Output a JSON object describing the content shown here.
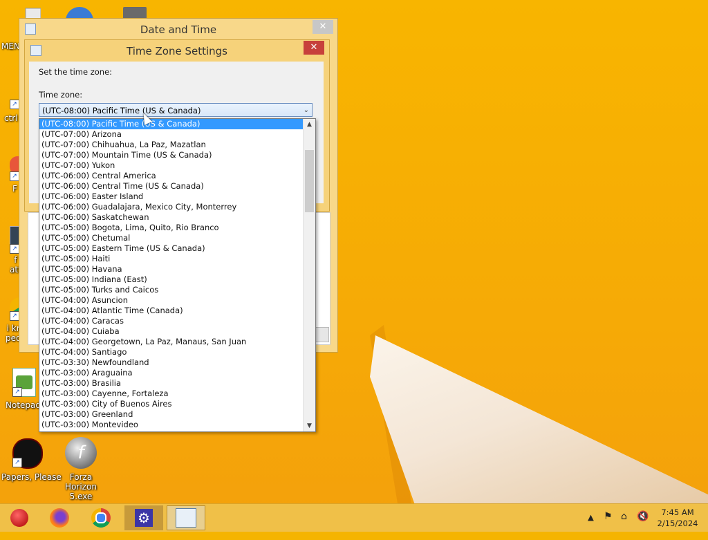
{
  "desktop": {
    "icons": [
      {
        "label": "MEN",
        "icon": "recycle-bin-icon"
      },
      {
        "label": "ctrl",
        "icon": "shortcut-icon"
      },
      {
        "label": "F",
        "icon": "app-icon"
      },
      {
        "label": "f\natt",
        "icon": "app-icon"
      },
      {
        "label": "i kr\npeo",
        "icon": "chrome-icon"
      },
      {
        "label": "Notepad",
        "icon": "notepad-icon"
      },
      {
        "label": "Papers, Please",
        "icon": "game-icon"
      },
      {
        "label": "Forza Horizon 5.exe",
        "icon": "flash-icon"
      }
    ]
  },
  "date_time_window": {
    "title": "Date and Time",
    "close": "✕"
  },
  "tz_window": {
    "title": "Time Zone Settings",
    "close": "✕",
    "set_label": "Set the time zone:",
    "tz_label": "Time zone:",
    "selected": "(UTC-08:00) Pacific Time (US & Canada)",
    "options": [
      "(UTC-08:00) Pacific Time (US & Canada)",
      "(UTC-07:00) Arizona",
      "(UTC-07:00) Chihuahua, La Paz, Mazatlan",
      "(UTC-07:00) Mountain Time (US & Canada)",
      "(UTC-07:00) Yukon",
      "(UTC-06:00) Central America",
      "(UTC-06:00) Central Time (US & Canada)",
      "(UTC-06:00) Easter Island",
      "(UTC-06:00) Guadalajara, Mexico City, Monterrey",
      "(UTC-06:00) Saskatchewan",
      "(UTC-05:00) Bogota, Lima, Quito, Rio Branco",
      "(UTC-05:00) Chetumal",
      "(UTC-05:00) Eastern Time (US & Canada)",
      "(UTC-05:00) Haiti",
      "(UTC-05:00) Havana",
      "(UTC-05:00) Indiana (East)",
      "(UTC-05:00) Turks and Caicos",
      "(UTC-04:00) Asuncion",
      "(UTC-04:00) Atlantic Time (Canada)",
      "(UTC-04:00) Caracas",
      "(UTC-04:00) Cuiaba",
      "(UTC-04:00) Georgetown, La Paz, Manaus, San Juan",
      "(UTC-04:00) Santiago",
      "(UTC-03:30) Newfoundland",
      "(UTC-03:00) Araguaina",
      "(UTC-03:00) Brasilia",
      "(UTC-03:00) Cayenne, Fortaleza",
      "(UTC-03:00) City of Buenos Aires",
      "(UTC-03:00) Greenland",
      "(UTC-03:00) Montevideo"
    ]
  },
  "taskbar": {
    "apps": [
      "ornament-icon",
      "firefox-icon",
      "chrome-icon",
      "settings-icon",
      "date-time-icon"
    ],
    "time": "7:45 AM",
    "date": "2/15/2024"
  }
}
